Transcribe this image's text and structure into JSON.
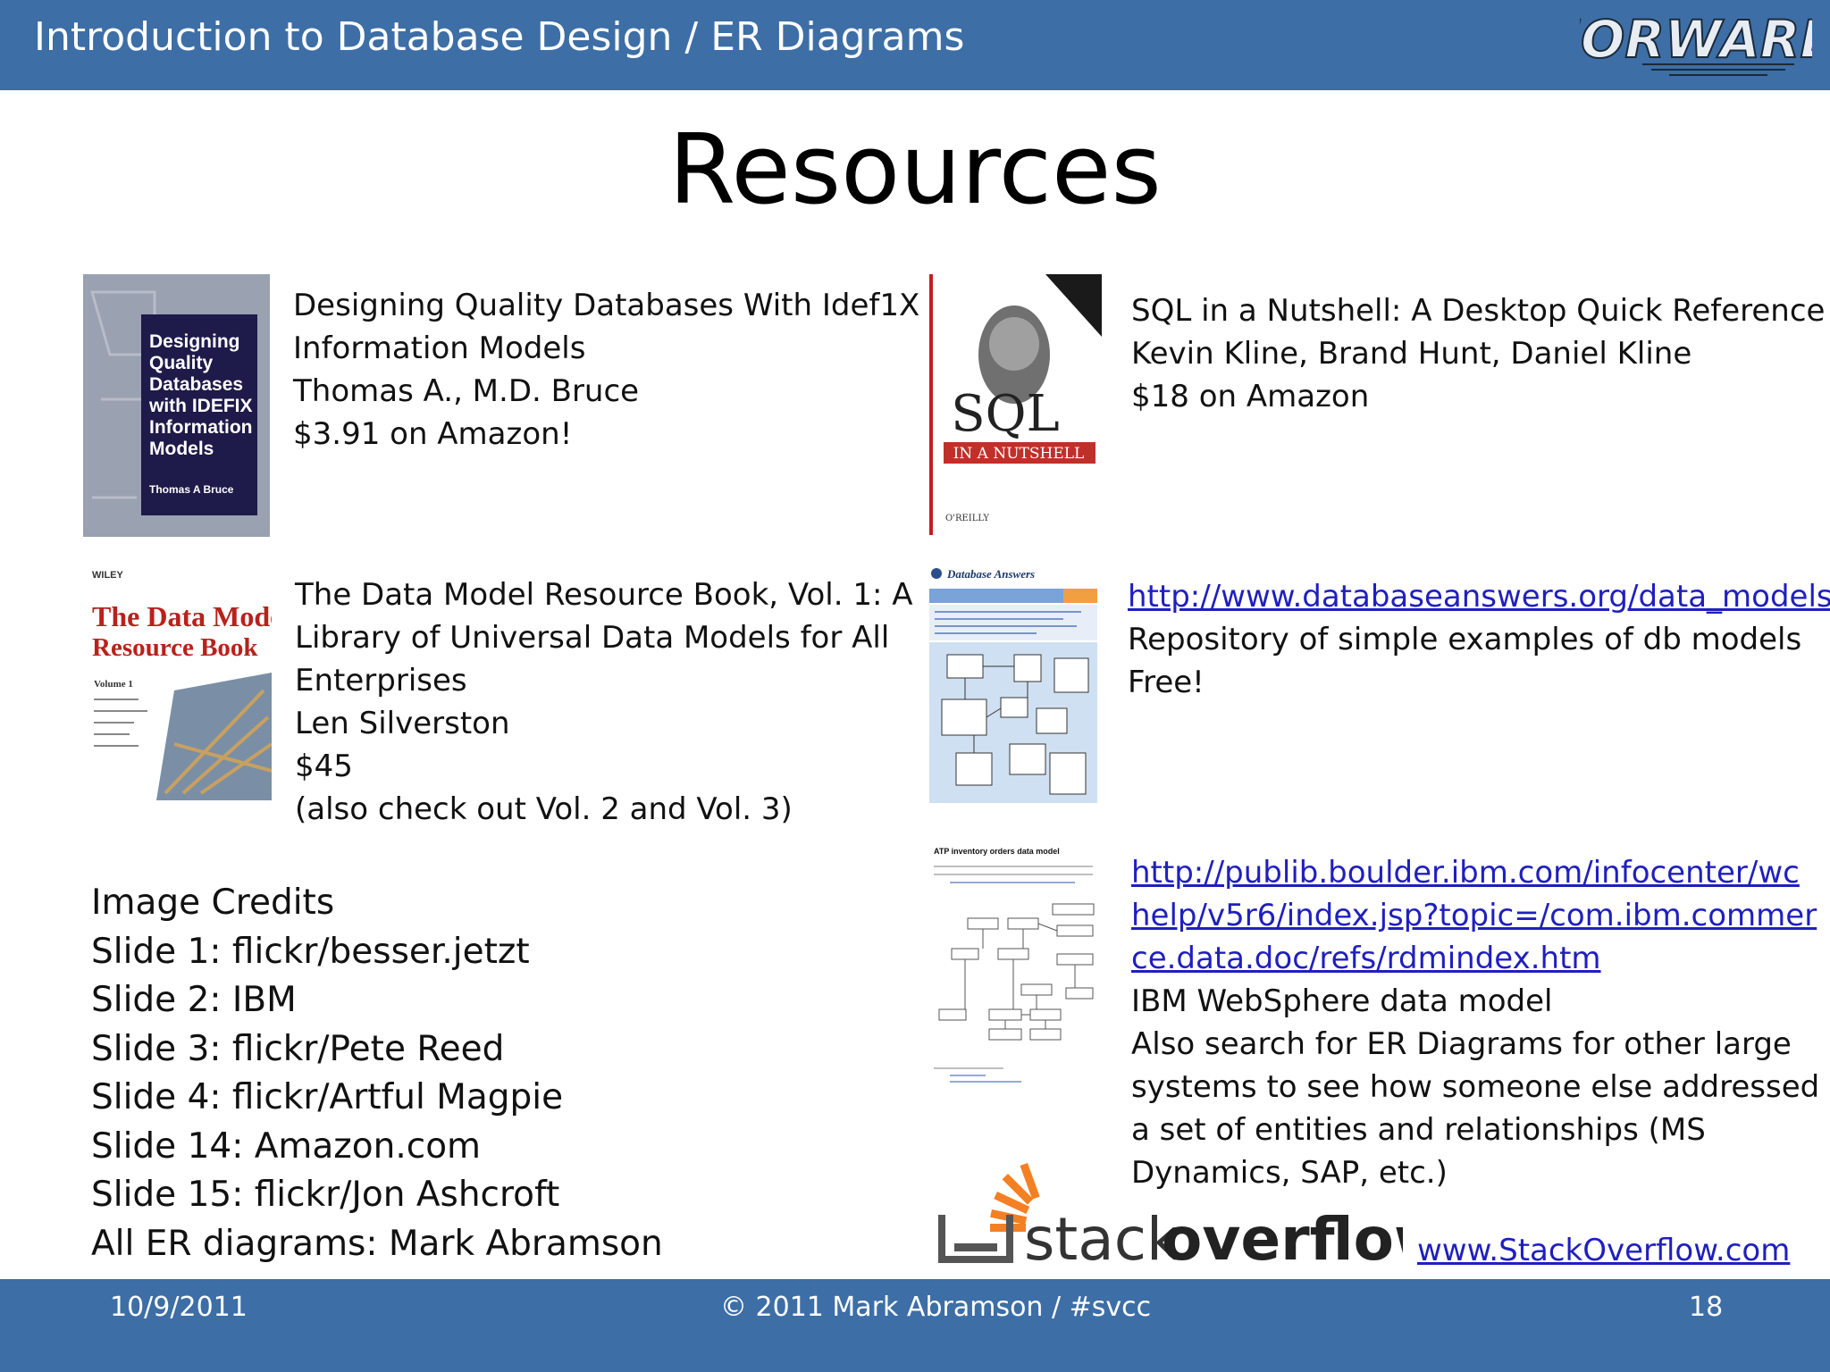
{
  "header": {
    "title": "Introduction to Database Design / ER Diagrams",
    "logo_text": "FORWARD"
  },
  "slide": {
    "title": "Resources"
  },
  "resources": [
    {
      "lines": [
        "Designing Quality Databases With Idef1X",
        "Information Models",
        "Thomas A., M.D. Bruce",
        "$3.91 on Amazon!"
      ],
      "cover_text": [
        "Designing",
        "Quality",
        "Databases",
        "with IDEFIX",
        "Information",
        "Models",
        "Thomas A Bruce"
      ]
    },
    {
      "lines": [
        "SQL in a Nutshell: A Desktop Quick Reference",
        "Kevin Kline, Brand Hunt, Daniel Kline",
        "$18 on Amazon"
      ],
      "cover_text": [
        "SQL",
        "IN A NUTSHELL",
        "O'REILLY"
      ]
    },
    {
      "lines": [
        "The Data Model Resource Book, Vol. 1: A",
        "Library of Universal Data Models for All",
        "Enterprises",
        "Len Silverston",
        "$45",
        "(also check out Vol. 2 and Vol. 3)"
      ],
      "cover_text": [
        "WILEY",
        "The Data Model",
        "Resource Book",
        "Volume 1"
      ]
    },
    {
      "link": "http://www.databaseanswers.org/data_models",
      "lines": [
        "Repository of simple examples of db models",
        "Free!"
      ],
      "cover_text": [
        "Database Answers"
      ]
    },
    {
      "link_lines": [
        "http://publib.boulder.ibm.com/infocenter/wc",
        "help/v5r6/index.jsp?topic=/com.ibm.commer",
        "ce.data.doc/refs/rdmindex.htm"
      ],
      "lines": [
        "IBM WebSphere data model",
        "Also search for ER Diagrams for other large",
        "systems to see how someone else addressed",
        "a set of entities and relationships (MS",
        "Dynamics, SAP, etc.)"
      ],
      "cover_text": [
        "ATP inventory orders data model"
      ]
    }
  ],
  "stackoverflow": {
    "logo_text_a": "stack",
    "logo_text_b": "overflow",
    "link": "www.StackOverflow.com"
  },
  "credits": [
    "Image Credits",
    "Slide 1: flickr/besser.jetzt",
    "Slide 2: IBM",
    "Slide 3: flickr/Pete Reed",
    "Slide 4: flickr/Artful Magpie",
    "Slide 14: Amazon.com",
    "Slide 15: flickr/Jon Ashcroft",
    "All ER diagrams: Mark Abramson"
  ],
  "footer": {
    "date": "10/9/2011",
    "copyright": "© 2011 Mark Abramson / #svcc",
    "page": "18"
  },
  "colors": {
    "header_bg": "#3d6ea6",
    "link": "#1f1fbf"
  }
}
